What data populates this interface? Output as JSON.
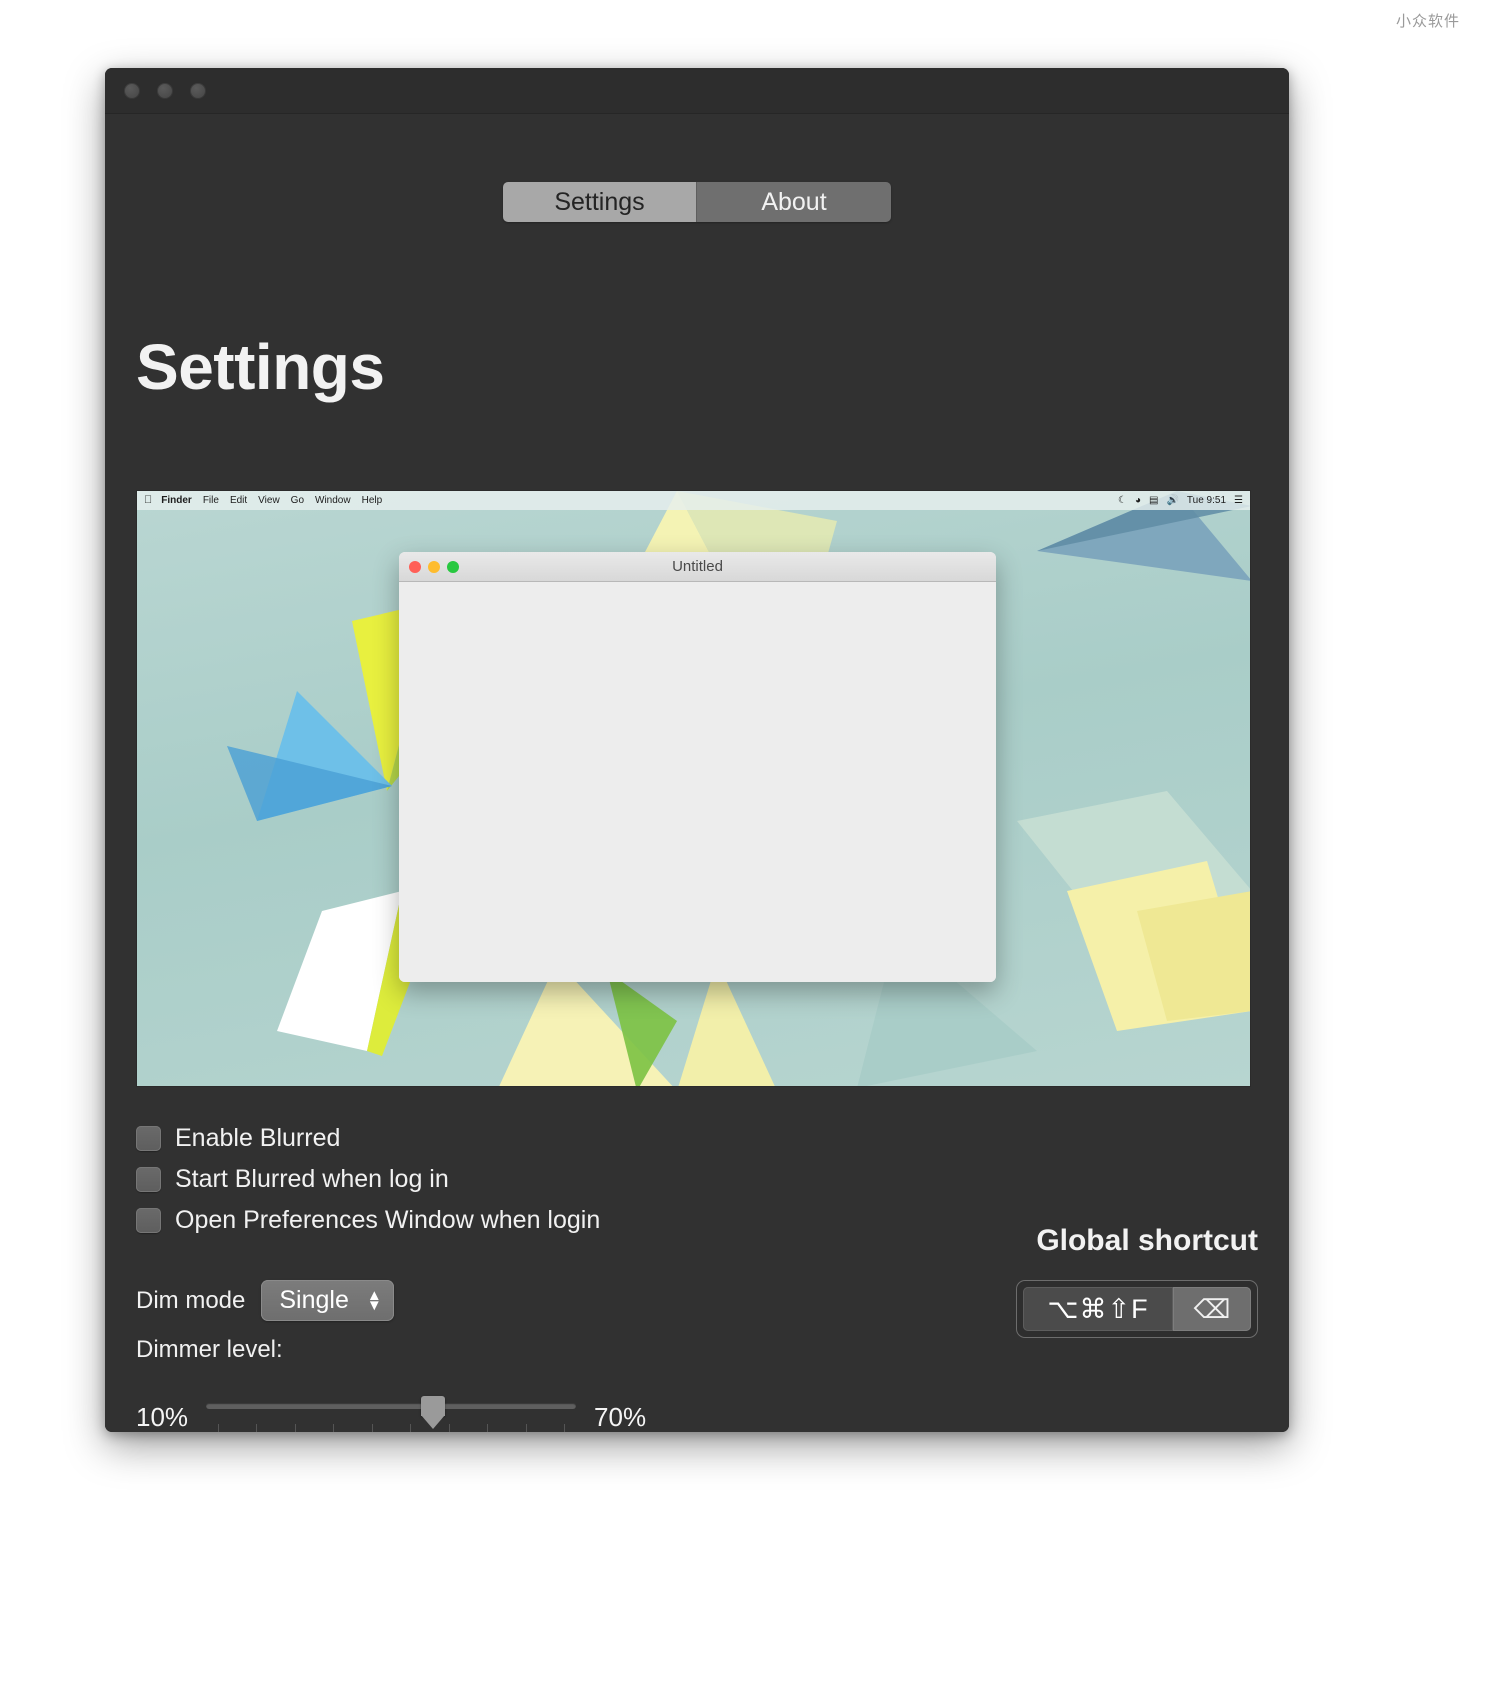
{
  "watermark": "小众软件",
  "window": {
    "traffic_lights": [
      "close",
      "minimize",
      "zoom"
    ]
  },
  "tabs": [
    {
      "label": "Settings",
      "active": true
    },
    {
      "label": "About",
      "active": false
    }
  ],
  "page": {
    "title": "Settings"
  },
  "preview": {
    "menubar": {
      "apple": "",
      "items": [
        "Finder",
        "File",
        "Edit",
        "View",
        "Go",
        "Window",
        "Help"
      ],
      "status_icons": [
        "bluetooth-icon",
        "wifi-icon",
        "battery-icon",
        "volume-icon"
      ],
      "clock": "Tue 9:51",
      "list_icon": "control-center-icon"
    },
    "inner_window": {
      "title": "Untitled",
      "lights": [
        "#ff5f57",
        "#febc2e",
        "#28c840"
      ]
    }
  },
  "options": {
    "checkboxes": [
      {
        "label": "Enable Blurred",
        "checked": false
      },
      {
        "label": "Start Blurred when log in",
        "checked": false
      },
      {
        "label": "Open Preferences Window when login",
        "checked": false
      }
    ],
    "dim_mode": {
      "label": "Dim mode",
      "value": "Single"
    },
    "dimmer_level": {
      "label": "Dimmer level:",
      "min_label": "10%",
      "max_label": "70%",
      "value_percent": 62,
      "tick_count": 10
    }
  },
  "global_shortcut": {
    "title": "Global shortcut",
    "keys": "⌥⌘⇧F",
    "clear_icon": "⌫"
  },
  "colors": {
    "window_bg": "#313131",
    "titlebar_bg": "#2d2d2d",
    "tab_active_bg": "#a8a8a8",
    "tab_inactive_bg": "#6f6f6f",
    "text": "#f1f1f1",
    "preview_bg": "#b4d2ce"
  }
}
